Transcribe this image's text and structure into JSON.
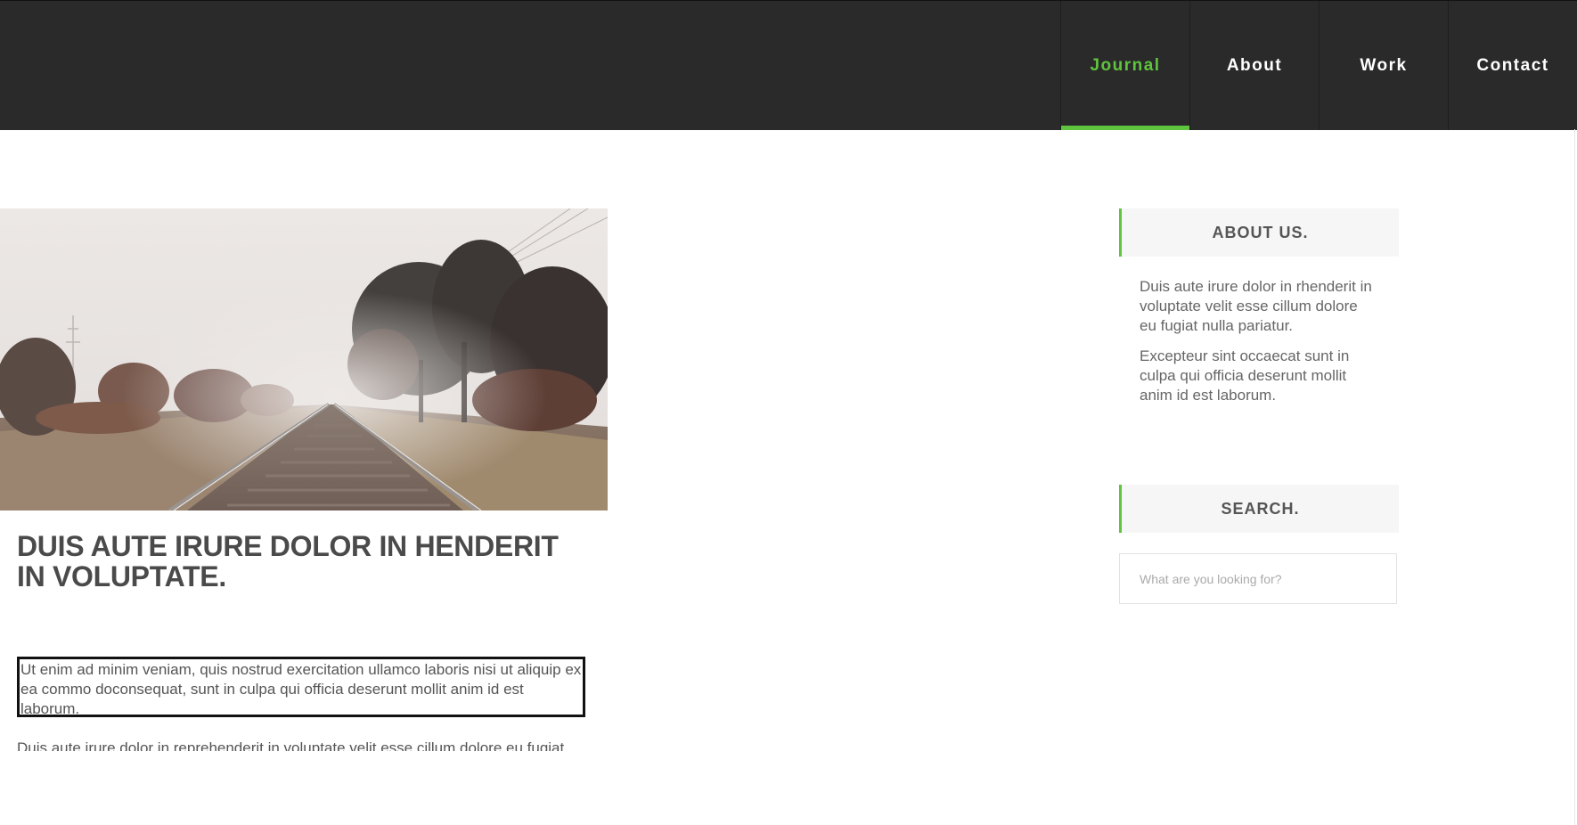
{
  "colors": {
    "accent": "#5fc43e",
    "header_bg": "#2a2a2a"
  },
  "nav": {
    "items": [
      {
        "label": "Journal",
        "active": true
      },
      {
        "label": "About",
        "active": false
      },
      {
        "label": "Work",
        "active": false
      },
      {
        "label": "Contact",
        "active": false
      }
    ]
  },
  "post": {
    "image": "railway-tracks-photo",
    "title": "DUIS AUTE IRURE DOLOR IN HENDERIT IN VOLUPTATE.",
    "excerpt": "Ut enim ad minim veniam, quis nostrud exercitation ullamco laboris nisi ut aliquip ex ea commo doconsequat, sunt in culpa qui officia deserunt mollit anim id est laborum.",
    "excerpt_next": "Duis aute irure dolor in reprehenderit in voluptate velit esse cillum dolore eu fugiat nulla pariatur."
  },
  "sidebar": {
    "about": {
      "heading": "ABOUT US.",
      "paragraphs": [
        "Duis aute irure dolor in rhenderit in voluptate velit esse cillum dolore eu fugiat nulla pariatur.",
        "Excepteur sint occaecat sunt in culpa qui officia deserunt mollit anim id est laborum."
      ]
    },
    "search": {
      "heading": "SEARCH.",
      "placeholder": "What are you looking for?"
    }
  }
}
